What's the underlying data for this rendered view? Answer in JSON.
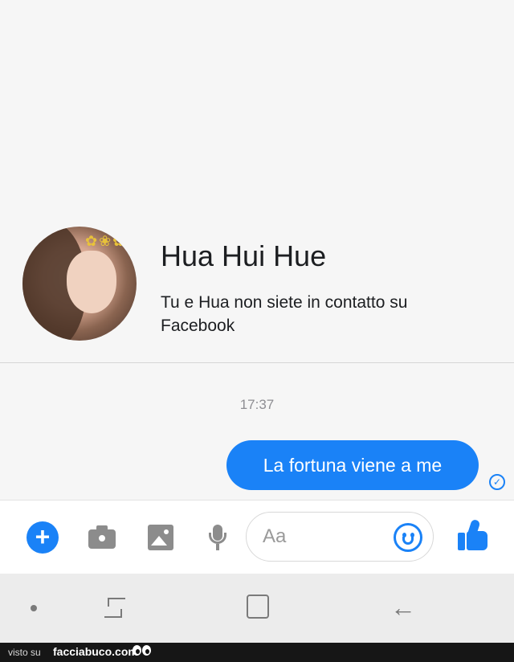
{
  "contact": {
    "name": "Hua Hui Hue",
    "subtitle": "Tu e Hua non siete in contatto su Facebook"
  },
  "conversation": {
    "timestamp": "17:37",
    "messages": [
      {
        "sender": "me",
        "text": "La fortuna viene a me",
        "status": "sent"
      }
    ]
  },
  "composer": {
    "placeholder": "Aa",
    "value": "",
    "icons": [
      "plus-icon",
      "camera-icon",
      "gallery-icon",
      "microphone-icon",
      "emoji-icon",
      "like-icon"
    ]
  },
  "navbar": {
    "icons": [
      "dot-icon",
      "recents-icon",
      "home-icon",
      "back-icon"
    ]
  },
  "footer": {
    "visto_label": "visto su",
    "brand": "facciabuco.com"
  },
  "colors": {
    "accent": "#1a82f7",
    "background": "#f6f6f6",
    "navbar": "#ececec"
  }
}
